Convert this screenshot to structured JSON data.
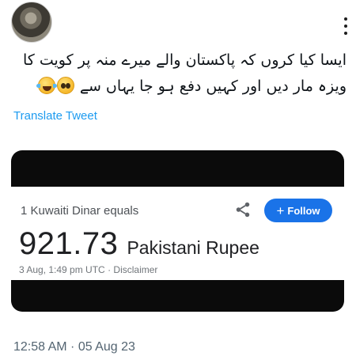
{
  "tweet": {
    "text_lines": [
      "ایسا کیا کروں کہ پاکستان والے میرے منہ پر کویت کا",
      "ویزہ مار دیں اور کہیں دفع ہو جا یہاں سے"
    ],
    "emojis": [
      "pleading-face-icon",
      "face-with-tears-of-joy-icon"
    ],
    "translate_label": "Translate Tweet",
    "timestamp": "12:58 AM · 05 Aug 23"
  },
  "card": {
    "from_label": "1 Kuwaiti Dinar equals",
    "follow_label": "Follow",
    "rate_value": "921.73",
    "rate_currency": "Pakistani Rupee",
    "meta_date": "3 Aug, 1:49 pm UTC",
    "meta_separator": " · ",
    "meta_disclaimer": "Disclaimer"
  },
  "colors": {
    "link": "#1d9bf0",
    "follow_button": "#1a73e8",
    "card_bars": "#0b0b0b",
    "secondary_text": "#536471"
  }
}
